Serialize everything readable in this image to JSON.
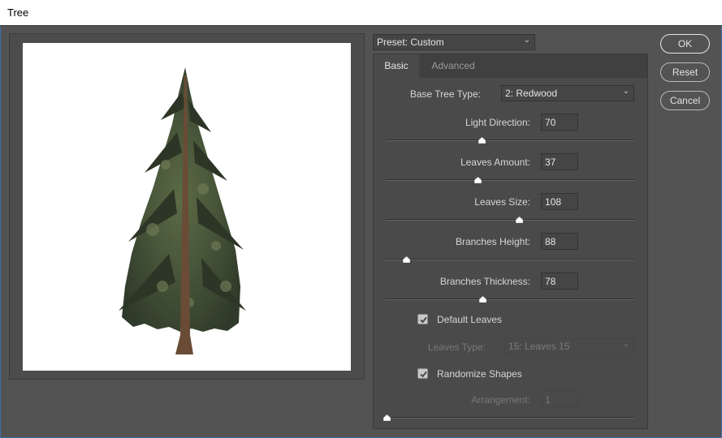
{
  "window": {
    "title": "Tree"
  },
  "preset": {
    "value": "Preset: Custom"
  },
  "tabs": [
    {
      "label": "Basic"
    },
    {
      "label": "Advanced"
    }
  ],
  "basic": {
    "base_tree_type": {
      "label": "Base Tree Type:",
      "value": "2: Redwood"
    },
    "light_direction": {
      "label": "Light Direction:",
      "value": "70"
    },
    "leaves_amount": {
      "label": "Leaves Amount:",
      "value": "37"
    },
    "leaves_size": {
      "label": "Leaves Size:",
      "value": "108"
    },
    "branches_height": {
      "label": "Branches Height:",
      "value": "88"
    },
    "branches_thickness": {
      "label": "Branches Thickness:",
      "value": "78"
    },
    "default_leaves": {
      "label": "Default Leaves",
      "checked": true
    },
    "leaves_type": {
      "label": "Leaves Type:",
      "value": "15: Leaves 15"
    },
    "randomize_shapes": {
      "label": "Randomize Shapes",
      "checked": true
    },
    "arrangement": {
      "label": "Arrangement:",
      "value": "1"
    }
  },
  "buttons": {
    "ok": "OK",
    "reset": "Reset",
    "cancel": "Cancel"
  }
}
